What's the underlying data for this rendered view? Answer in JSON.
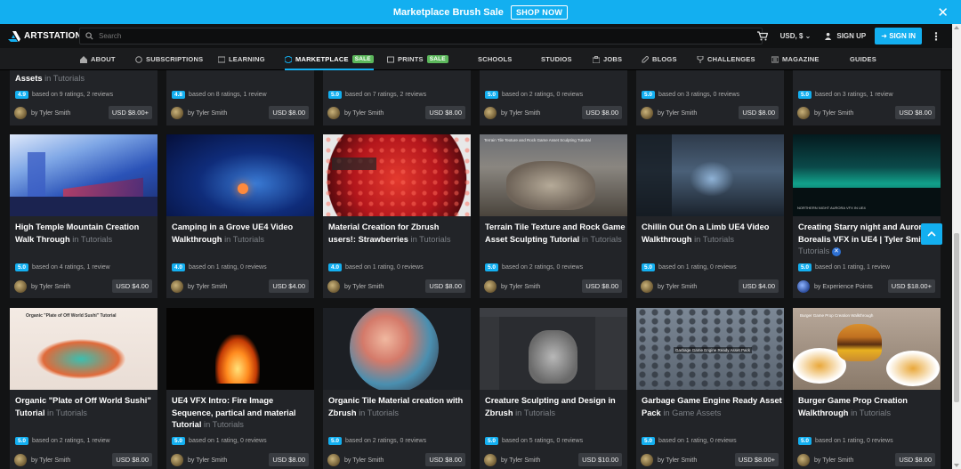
{
  "promo": {
    "text": "Marketplace Brush Sale",
    "button": "SHOP NOW",
    "close": "✕"
  },
  "header": {
    "logo": "ARTSTATION",
    "search_placeholder": "Search",
    "currency": "USD, $",
    "signup": "SIGN UP",
    "signin": "SIGN IN",
    "more": "⋮"
  },
  "nav": [
    {
      "label": "ABOUT",
      "icon": "home-icon"
    },
    {
      "label": "SUBSCRIPTIONS",
      "icon": "subscriptions-icon"
    },
    {
      "label": "LEARNING",
      "icon": "learning-icon"
    },
    {
      "label": "MARKETPLACE",
      "icon": "marketplace-icon",
      "badge": "SALE"
    },
    {
      "label": "PRINTS",
      "icon": "prints-icon",
      "badge": "SALE"
    },
    {
      "label": "SCHOOLS"
    },
    {
      "label": "STUDIOS"
    },
    {
      "label": "JOBS",
      "icon": "jobs-icon"
    },
    {
      "label": "BLOGS",
      "icon": "blogs-icon"
    },
    {
      "label": "CHALLENGES",
      "icon": "challenges-icon"
    },
    {
      "label": "MAGAZINE",
      "icon": "magazine-icon"
    },
    {
      "label": "GUIDES"
    }
  ],
  "colors": {
    "accent": "#13aff0",
    "sale": "#5cb85c",
    "bg": "#121314",
    "card": "#222428"
  },
  "row0": [
    {
      "title": "Assets",
      "cat": "in Tutorials",
      "rating": "4.9",
      "rating_text": "based on 9 ratings, 2 reviews",
      "author": "by Tyler Smith",
      "price": "USD $8.00+"
    },
    {
      "title": "",
      "cat": "",
      "rating": "4.8",
      "rating_text": "based on 8 ratings, 1 review",
      "author": "by Tyler Smith",
      "price": "USD $8.00"
    },
    {
      "title": "",
      "cat": "",
      "rating": "5.0",
      "rating_text": "based on 7 ratings, 2 reviews",
      "author": "by Tyler Smith",
      "price": "USD $8.00"
    },
    {
      "title": "",
      "cat": "",
      "rating": "5.0",
      "rating_text": "based on 2 ratings, 0 reviews",
      "author": "by Tyler Smith",
      "price": "USD $8.00"
    },
    {
      "title": "",
      "cat": "",
      "rating": "5.0",
      "rating_text": "based on 3 ratings, 0 reviews",
      "author": "by Tyler Smith",
      "price": "USD $8.00"
    },
    {
      "title": "",
      "cat": "",
      "rating": "5.0",
      "rating_text": "based on 3 ratings, 1 review",
      "author": "by Tyler Smith",
      "price": "USD $8.00"
    }
  ],
  "row1": [
    {
      "title": "High Temple Mountain Creation Walk Through",
      "cat": "in Tutorials",
      "rating": "5.0",
      "rating_text": "based on 4 ratings, 1 review",
      "author": "by Tyler Smith",
      "price": "USD $4.00"
    },
    {
      "title": "Camping in a Grove UE4 Video Walkthrough",
      "cat": "in Tutorials",
      "rating": "4.0",
      "rating_text": "based on 1 rating, 0 reviews",
      "author": "by Tyler Smith",
      "price": "USD $4.00"
    },
    {
      "title": "Material Creation for Zbrush users!: Strawberries",
      "cat": "in Tutorials",
      "rating": "4.0",
      "rating_text": "based on 1 rating, 0 reviews",
      "author": "by Tyler Smith",
      "price": "USD $8.00"
    },
    {
      "title": "Terrain Tile Texture and Rock Game Asset Sculpting Tutorial",
      "cat": "in Tutorials",
      "rating": "5.0",
      "rating_text": "based on 2 ratings, 0 reviews",
      "author": "by Tyler Smith",
      "price": "USD $8.00"
    },
    {
      "title": "Chillin Out On a Limb UE4 Video Walkthrough",
      "cat": "in Tutorials",
      "rating": "5.0",
      "rating_text": "based on 1 rating, 0 reviews",
      "author": "by Tyler Smith",
      "price": "USD $4.00"
    },
    {
      "title": "Creating Starry night and Aurora Borealis VFX in UE4 | Tyler Smith",
      "cat": "in Tutorials",
      "rating": "5.0",
      "rating_text": "based on 1 rating, 1 review",
      "author": "by Experience Points",
      "price": "USD $18.00+"
    }
  ],
  "row2": [
    {
      "title": "Organic \"Plate of Off World Sushi\" Tutorial",
      "cat": "in Tutorials",
      "rating": "5.0",
      "rating_text": "based on 2 ratings, 1 review",
      "author": "by Tyler Smith",
      "price": "USD $8.00"
    },
    {
      "title": "UE4 VFX Intro: Fire Image Sequence, partical and material Tutorial",
      "cat": "in Tutorials",
      "rating": "5.0",
      "rating_text": "based on 1 rating, 0 reviews",
      "author": "by Tyler Smith",
      "price": "USD $8.00"
    },
    {
      "title": "Organic Tile Material creation with Zbrush",
      "cat": "in Tutorials",
      "rating": "5.0",
      "rating_text": "based on 2 ratings, 0 reviews",
      "author": "by Tyler Smith",
      "price": "USD $8.00"
    },
    {
      "title": "Creature Sculpting and Design in Zbrush",
      "cat": "in Tutorials",
      "rating": "5.0",
      "rating_text": "based on 5 ratings, 0 reviews",
      "author": "by Tyler Smith",
      "price": "USD $10.00"
    },
    {
      "title": "Garbage Game Engine Ready Asset Pack",
      "cat": "in Game Assets",
      "rating": "5.0",
      "rating_text": "based on 1 rating, 0 reviews",
      "author": "by Tyler Smith",
      "price": "USD $8.00+"
    },
    {
      "title": "Burger Game Prop Creation Walkthrough",
      "cat": "in Tutorials",
      "rating": "5.0",
      "rating_text": "based on 1 rating, 0 reviews",
      "author": "by Tyler Smith",
      "price": "USD $8.00"
    }
  ],
  "img_text": {
    "terrain": "Terrain Tile Texture and Rock Game Asset Sculpting Tutorial",
    "sushi": "Organic \"Plate of Off World Sushi\" Tutorial",
    "burger": "Burger Game Prop Creation Walkthrough",
    "garbage": "Garbage Game Engine Ready Asset Pack",
    "aurora": "NORTHERN NIGHT AURORA VFX IN UE4"
  }
}
